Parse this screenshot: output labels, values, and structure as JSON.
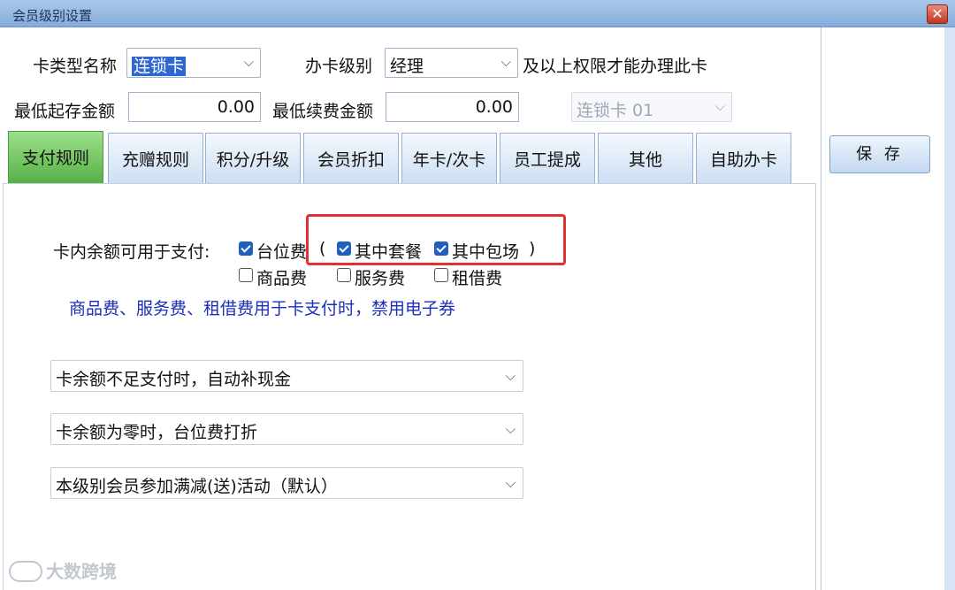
{
  "window": {
    "title": "会员级别设置",
    "close_glyph": "✕"
  },
  "header": {
    "card_type_label": "卡类型名称",
    "card_type_value": "连锁卡",
    "level_label": "办卡级别",
    "level_value": "经理",
    "level_suffix": "及以上权限才能办理此卡",
    "min_deposit_label": "最低起存金额",
    "min_deposit_value": "0.00",
    "min_renew_label": "最低续费金额",
    "min_renew_value": "0.00",
    "linked_card_value": "连锁卡 01"
  },
  "tabs": [
    {
      "label": "支付规则",
      "active": true
    },
    {
      "label": "充赠规则"
    },
    {
      "label": "积分/升级"
    },
    {
      "label": "会员折扣"
    },
    {
      "label": "年卡/次卡"
    },
    {
      "label": "员工提成"
    },
    {
      "label": "其他"
    },
    {
      "label": "自助办卡"
    }
  ],
  "payment_rules": {
    "balance_label": "卡内余额可用于支付:",
    "table_fee": {
      "label": "台位费",
      "checked": true
    },
    "paren_open": "(",
    "package": {
      "label": "其中套餐",
      "checked": true
    },
    "private_booking": {
      "label": "其中包场",
      "checked": true
    },
    "paren_close": ")",
    "goods_fee": {
      "label": "商品费",
      "checked": false
    },
    "service_fee": {
      "label": "服务费",
      "checked": false
    },
    "rental_fee": {
      "label": "租借费",
      "checked": false
    },
    "note": "商品费、服务费、租借费用于卡支付时，禁用电子券",
    "dropdowns": [
      "卡余额不足支付时，自动补现金",
      "卡余额为零时，台位费打折",
      "本级别会员参加满减(送)活动（默认）"
    ]
  },
  "actions": {
    "save_label": "保 存"
  },
  "watermark": "大数跨境",
  "colors": {
    "active_tab": "#56b146",
    "highlight": "#e03232",
    "note": "#1c2fb8",
    "checked": "#1f5fbf"
  }
}
